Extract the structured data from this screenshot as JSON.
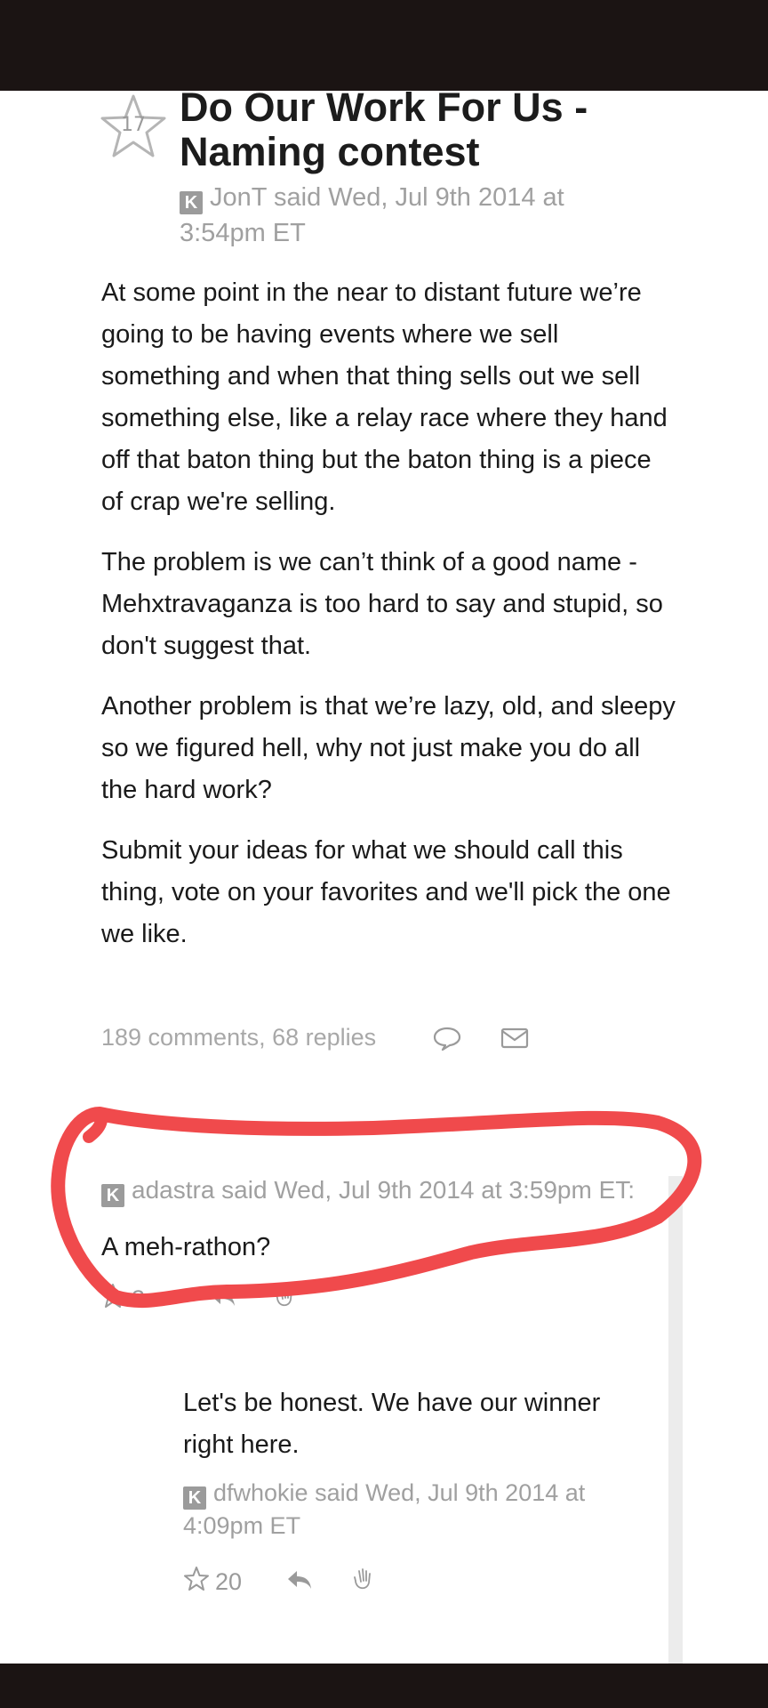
{
  "post": {
    "star_count": "17",
    "title": "Do Our Work For Us - Naming contest",
    "badge": "K",
    "meta": "JonT said Wed, Jul 9th 2014 at 3:54pm ET",
    "paragraphs": [
      "At some point in the near to distant future we’re going to be having events where we sell something and when that thing sells out we sell something else, like a relay race where they hand off that baton thing but the baton thing is a piece of crap we're selling.",
      "The problem is we can’t think of a good name - Mehxtravaganza is too hard to say and stupid, so don't suggest that.",
      "Another problem is that we’re lazy, old, and sleepy so we figured hell, why not just make you do all the hard work?",
      "Submit your ideas for what we should call this thing, vote on your favorites and we'll pick the one we like."
    ],
    "stats": "189 comments, 68 replies"
  },
  "comment": {
    "badge": "K",
    "meta": "adastra said Wed, Jul 9th 2014 at 3:59pm ET:",
    "text": "A meh-rathon?",
    "star_count": "3"
  },
  "reply": {
    "text": "Let's be honest. We have our winner right here.",
    "badge": "K",
    "meta": "dfwhokie said Wed, Jul 9th 2014 at 4:09pm ET",
    "star_count": "20"
  },
  "colors": {
    "topbar": "#1b1413",
    "meta_gray": "#a0a0a0",
    "annotation_red": "#f04a4c"
  }
}
